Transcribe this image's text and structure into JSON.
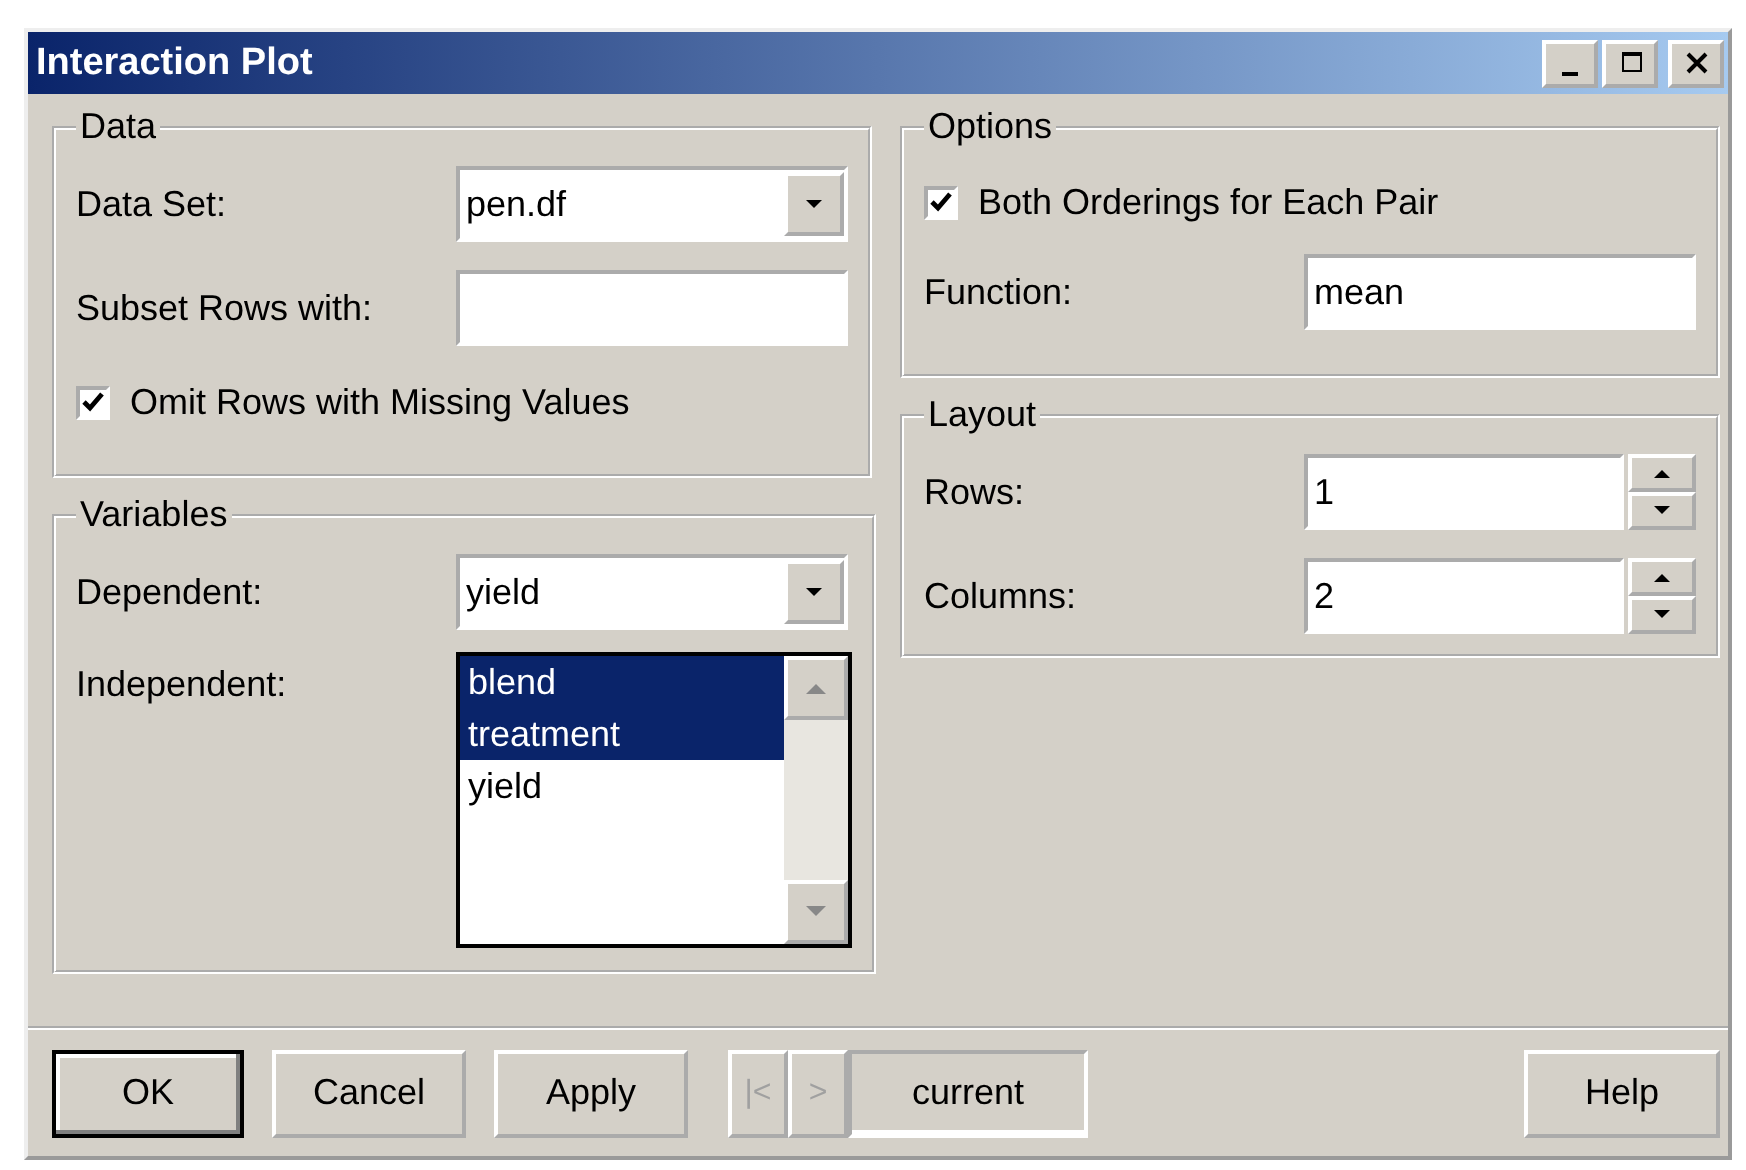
{
  "window": {
    "title": "Interaction Plot"
  },
  "data_group": {
    "title": "Data",
    "data_set": {
      "label": "Data Set:",
      "value": "pen.df"
    },
    "subset": {
      "label": "Subset Rows with:"
    },
    "omit_missing": {
      "label": "Omit Rows with Missing Values",
      "checked": true
    }
  },
  "variables_group": {
    "title": "Variables",
    "dependent": {
      "label": "Dependent:",
      "value": "yield"
    },
    "independent": {
      "label": "Independent:",
      "items": [
        {
          "label": "blend",
          "selected": true
        },
        {
          "label": "treatment",
          "selected": true
        },
        {
          "label": "yield",
          "selected": false
        }
      ]
    }
  },
  "options_group": {
    "title": "Options",
    "both_orderings": {
      "label": "Both Orderings for Each Pair",
      "checked": true
    },
    "function": {
      "label": "Function:",
      "value": "mean"
    }
  },
  "layout_group": {
    "title": "Layout",
    "rows": {
      "label": "Rows:",
      "value": "1"
    },
    "columns": {
      "label": "Columns:",
      "value": "2"
    }
  },
  "buttons": [
    {
      "label": "OK",
      "kind": "default"
    },
    {
      "label": "Cancel",
      "kind": "normal"
    },
    {
      "label": "Apply",
      "kind": "normal"
    },
    {
      "label": "|<",
      "kind": "nav",
      "disabled": true
    },
    {
      "label": ">",
      "kind": "nav",
      "disabled": true
    },
    {
      "label": "current",
      "kind": "status"
    },
    {
      "label": "Help",
      "kind": "right"
    }
  ]
}
